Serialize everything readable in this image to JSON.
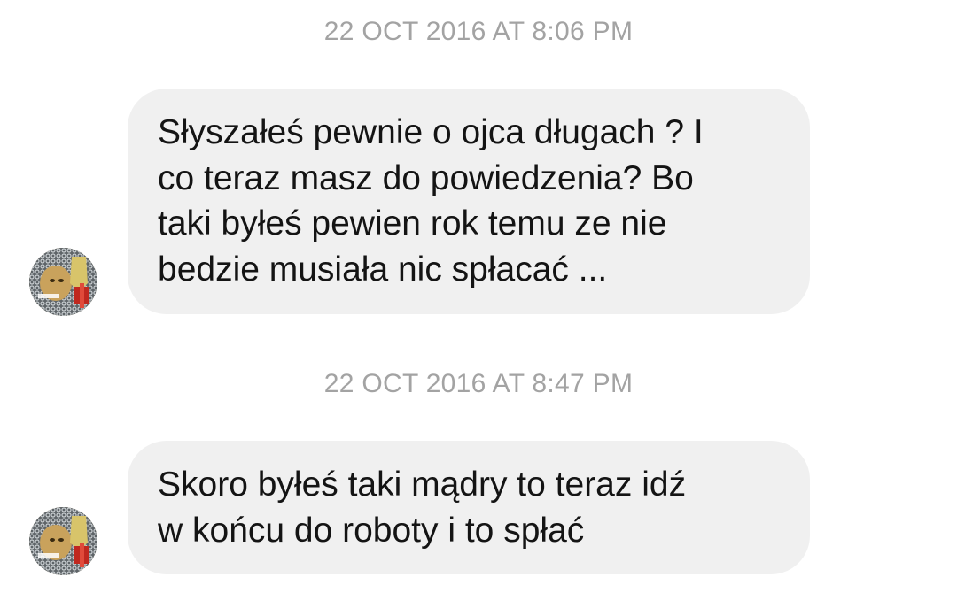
{
  "conversation": {
    "messages": [
      {
        "timestamp": "22 OCT 2016 AT 8:06 PM",
        "lines": [
          "Słyszałeś pewnie o ojca długach ? I",
          "co teraz masz do powiedzenia? Bo",
          "taki byłeś pewien rok temu ze nie",
          "bedzie musiała nic spłacać ..."
        ]
      },
      {
        "timestamp": "22 OCT 2016 AT 8:47 PM",
        "lines": [
          "Skoro byłeś taki mądry to teraz idź",
          "w końcu do roboty i to spłać"
        ]
      }
    ]
  },
  "colors": {
    "bubble_background": "#f0f0f0",
    "message_text": "#141414",
    "timestamp_text": "#a3a3a3",
    "background": "#ffffff"
  },
  "icons": {
    "avatar": "contact-avatar-cat-in-chainmail"
  }
}
